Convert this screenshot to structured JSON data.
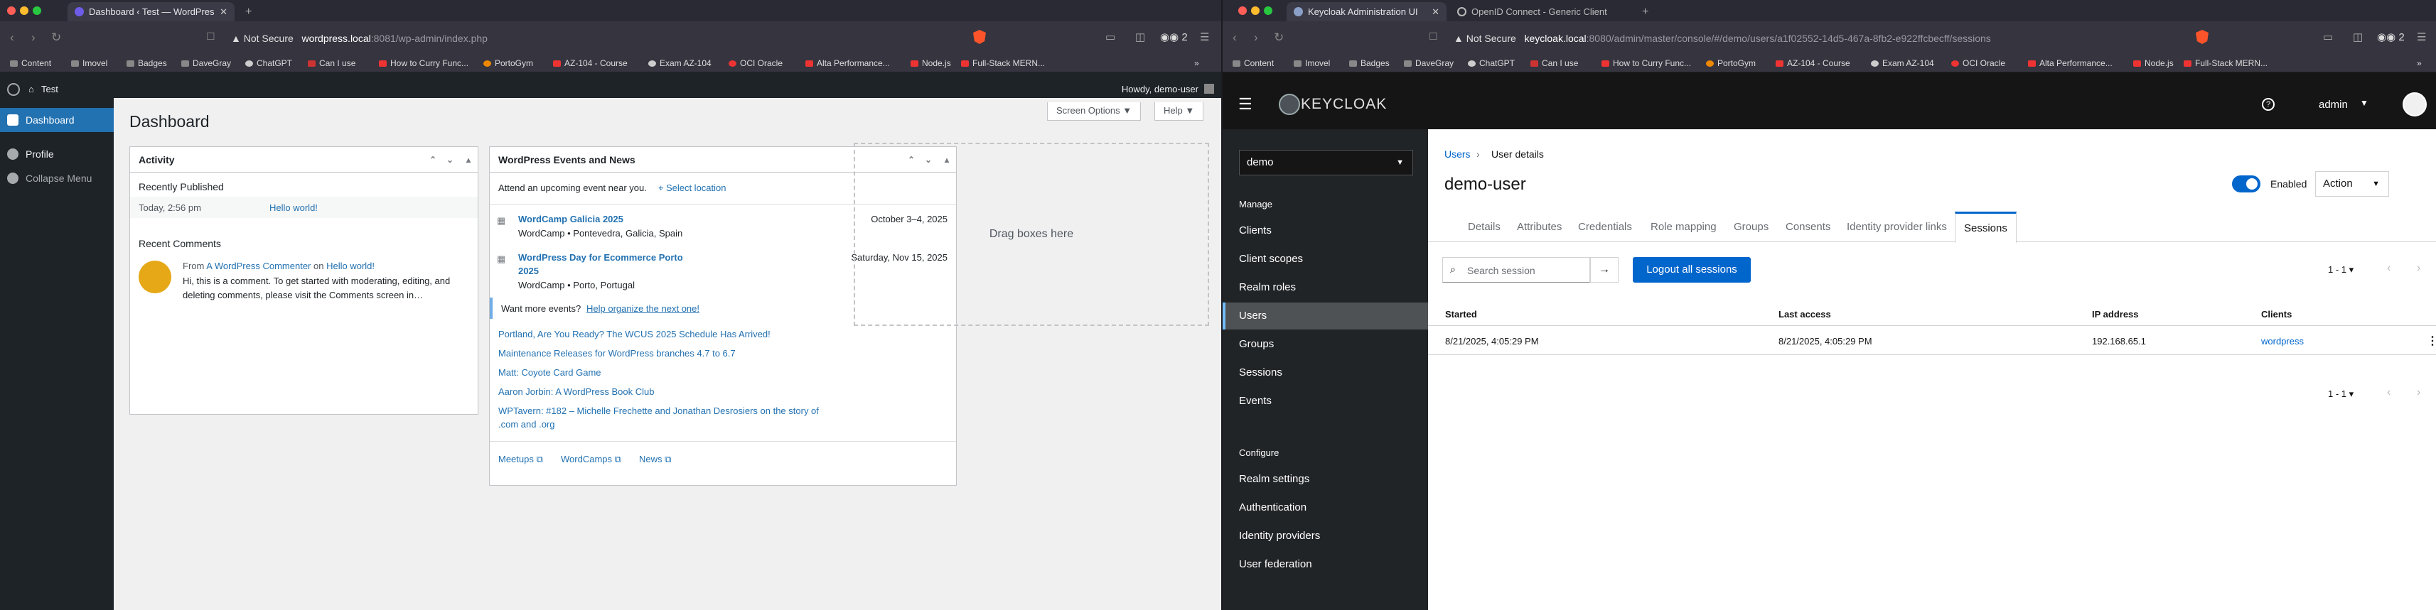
{
  "left_window": {
    "tab_title": "Dashboard ‹ Test — WordPres",
    "url": {
      "not_secure": "Not Secure",
      "host": "wordpress.local",
      "path": ":8081/wp-admin/index.php"
    },
    "ext_count": "2",
    "bookmarks": [
      "Content",
      "Imovel",
      "Badges",
      "DaveGray",
      "ChatGPT",
      "Can I use",
      "How to Curry Func...",
      "PortoGym",
      "AZ-104 - Course",
      "Exam AZ-104",
      "OCI Oracle",
      "Alta Performance...",
      "Node.js",
      "Full-Stack MERN..."
    ],
    "wp": {
      "site_name": "Test",
      "howdy": "Howdy, demo-user",
      "menu": {
        "dashboard": "Dashboard",
        "profile": "Profile",
        "collapse": "Collapse Menu"
      },
      "page_title": "Dashboard",
      "screen_options": "Screen Options ▼",
      "help": "Help ▼",
      "activity": {
        "title": "Activity",
        "recently_published": "Recently Published",
        "pub_date": "Today, 2:56 pm",
        "pub_link": "Hello world!",
        "recent_comments": "Recent Comments",
        "from_prefix": "From",
        "commenter": "A WordPress Commenter",
        "on": "on",
        "comment_post": "Hello world!",
        "comment_text1": "Hi, this is a comment. To get started with moderating, editing, and",
        "comment_text2": "deleting comments, please visit the Comments screen in…"
      },
      "events": {
        "title": "WordPress Events and News",
        "attend": "Attend an upcoming event near you.",
        "select_location": "Select location",
        "items": [
          {
            "title": "WordCamp Galicia 2025",
            "date": "October 3–4, 2025",
            "place": "WordCamp • Pontevedra, Galicia, Spain"
          },
          {
            "title": "WordPress Day for Ecommerce Porto",
            "title2": "2025",
            "date": "Saturday, Nov 15, 2025",
            "place": "WordCamp • Porto, Portugal"
          }
        ],
        "want_more": "Want more events?",
        "help_organize": "Help organize the next one!",
        "news": [
          "Portland, Are You Ready? The WCUS 2025 Schedule Has Arrived!",
          "Maintenance Releases for WordPress branches 4.7 to 6.7",
          "Matt: Coyote Card Game",
          "Aaron Jorbin: A WordPress Book Club",
          "WPTavern: #182 – Michelle Frechette and Jonathan Desrosiers on the story of",
          ".com and .org"
        ],
        "footer": [
          "Meetups",
          "WordCamps",
          "News"
        ]
      },
      "drag_boxes": "Drag boxes here"
    }
  },
  "right_window": {
    "tab_title": "Keycloak Administration UI",
    "tab2_title": "OpenID Connect - Generic Client",
    "url": {
      "not_secure": "Not Secure",
      "host": "keycloak.local",
      "path": ":8080/admin/master/console/#/demo/users/a1f02552-14d5-467a-8fb2-e922ffcbecff/sessions"
    },
    "ext_count": "2",
    "bookmarks": [
      "Content",
      "Imovel",
      "Badges",
      "DaveGray",
      "ChatGPT",
      "Can I use",
      "How to Curry Func...",
      "PortoGym",
      "AZ-104 - Course",
      "Exam AZ-104",
      "OCI Oracle",
      "Alta Performance...",
      "Node.js",
      "Full-Stack MERN..."
    ],
    "kc": {
      "logo": "KEYCLOAK",
      "user": "admin",
      "realm": "demo",
      "manage_label": "Manage",
      "manage_items": [
        "Clients",
        "Client scopes",
        "Realm roles",
        "Users",
        "Groups",
        "Sessions",
        "Events"
      ],
      "configure_label": "Configure",
      "configure_items": [
        "Realm settings",
        "Authentication",
        "Identity providers",
        "User federation"
      ],
      "breadcrumb": {
        "users": "Users",
        "current": "User details"
      },
      "username": "demo-user",
      "enabled": "Enabled",
      "action": "Action",
      "tabs": [
        "Details",
        "Attributes",
        "Credentials",
        "Role mapping",
        "Groups",
        "Consents",
        "Identity provider links",
        "Sessions"
      ],
      "search_placeholder": "Search session",
      "logout_all": "Logout all sessions",
      "pagination": "1 - 1",
      "columns": [
        "Started",
        "Last access",
        "IP address",
        "Clients"
      ],
      "row": {
        "started": "8/21/2025, 4:05:29 PM",
        "last_access": "8/21/2025, 4:05:29 PM",
        "ip": "192.168.65.1",
        "client": "wordpress"
      }
    }
  },
  "colors": {
    "wp_blue": "#2271b1",
    "wp_dark": "#1d2327",
    "kc_blue": "#0066cc",
    "kc_dark": "#151515"
  }
}
